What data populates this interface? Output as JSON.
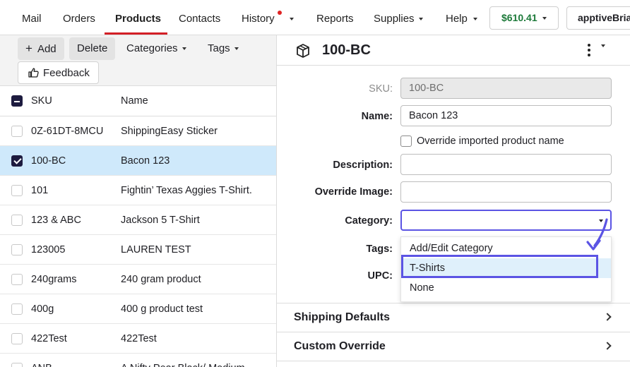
{
  "nav": {
    "items": [
      {
        "label": "Mail"
      },
      {
        "label": "Orders"
      },
      {
        "label": "Products",
        "active": true
      },
      {
        "label": "Contacts"
      },
      {
        "label": "History",
        "has_dot": true,
        "has_caret": true
      },
      {
        "label": "Reports"
      },
      {
        "label": "Supplies",
        "has_caret": true
      },
      {
        "label": "Help",
        "has_caret": true
      }
    ],
    "balance": "$610.41",
    "account": "apptiveBrian",
    "active_color": "#d31f26",
    "balance_color": "#1d7a3a"
  },
  "toolbar": {
    "add_label": "Add",
    "delete_label": "Delete",
    "categories_label": "Categories",
    "tags_label": "Tags",
    "feedback_label": "Feedback"
  },
  "table": {
    "headers": {
      "sku": "SKU",
      "name": "Name"
    },
    "rows": [
      {
        "sku": "0Z-61DT-8MCU",
        "name": "ShippingEasy Sticker",
        "checked": false
      },
      {
        "sku": "100-BC",
        "name": "Bacon 123",
        "checked": true
      },
      {
        "sku": "101",
        "name": "Fightin’ Texas Aggies T-Shirt.",
        "checked": false
      },
      {
        "sku": "123 & ABC",
        "name": "Jackson 5 T-Shirt",
        "checked": false
      },
      {
        "sku": "123005",
        "name": "LAUREN TEST",
        "checked": false
      },
      {
        "sku": "240grams",
        "name": "240 gram product",
        "checked": false
      },
      {
        "sku": "400g",
        "name": "400 g product test",
        "checked": false
      },
      {
        "sku": "422Test",
        "name": "422Test",
        "checked": false
      },
      {
        "sku": "ANB",
        "name": "A Nifty Pear Black/ Medium",
        "checked": false
      }
    ],
    "selected_color": "#cfe9fb"
  },
  "detail": {
    "title": "100-BC",
    "sku_label": "SKU:",
    "sku_value": "100-BC",
    "name_label": "Name:",
    "name_value": "Bacon 123",
    "override_name_label": "Override imported product name",
    "description_label": "Description:",
    "description_value": "",
    "override_image_label": "Override Image:",
    "override_image_value": "",
    "category_label": "Category:",
    "category_value": "",
    "tags_label": "Tags:",
    "upc_label": "UPC:",
    "category_options": [
      "Add/Edit Category",
      "T-Shirts",
      "None"
    ],
    "highlighted_option": "T-Shirts",
    "sections": [
      "Shipping Defaults",
      "Custom Override"
    ],
    "focus_color": "#5b54e4"
  }
}
